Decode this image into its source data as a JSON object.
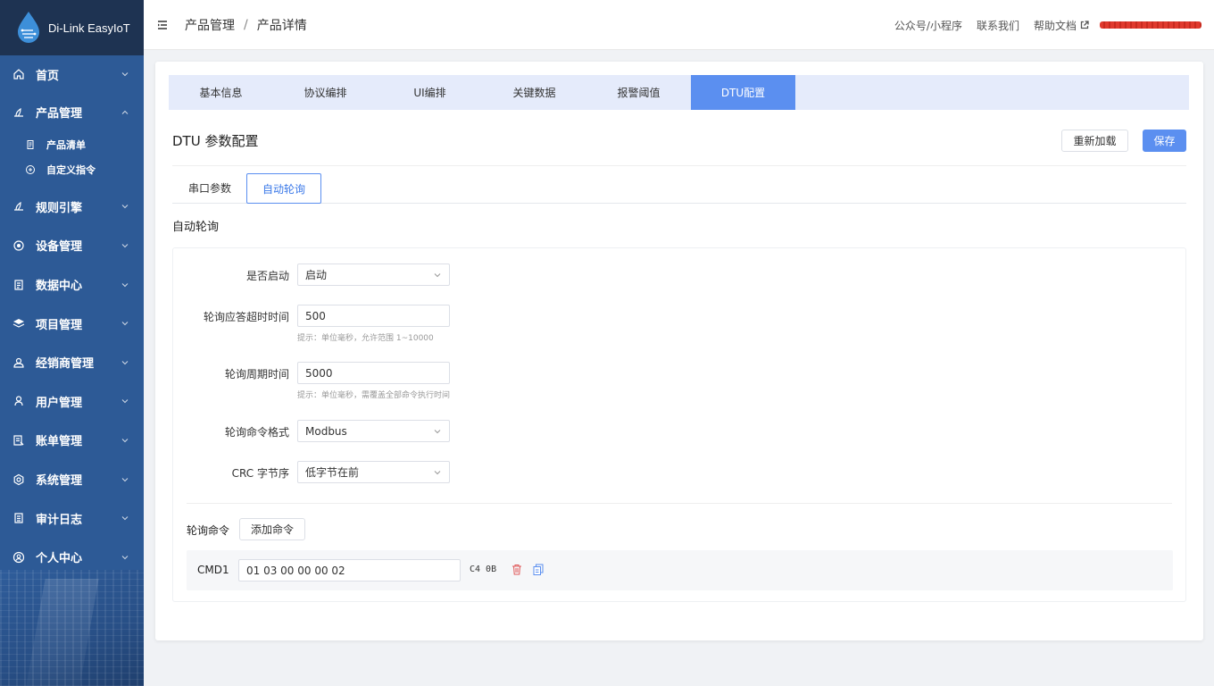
{
  "brand": {
    "name": "Di-Link EasyIoT"
  },
  "sidebar": {
    "items": [
      {
        "label": "首页",
        "icon": "home-icon"
      },
      {
        "label": "产品管理",
        "icon": "product-icon",
        "expanded": true,
        "children": [
          {
            "label": "产品清单",
            "icon": "list-icon"
          },
          {
            "label": "自定义指令",
            "icon": "command-icon"
          }
        ]
      },
      {
        "label": "规则引擎",
        "icon": "rule-icon"
      },
      {
        "label": "设备管理",
        "icon": "device-icon"
      },
      {
        "label": "数据中心",
        "icon": "data-icon"
      },
      {
        "label": "项目管理",
        "icon": "layers-icon"
      },
      {
        "label": "经销商管理",
        "icon": "dealer-icon"
      },
      {
        "label": "用户管理",
        "icon": "user-icon"
      },
      {
        "label": "账单管理",
        "icon": "bill-icon"
      },
      {
        "label": "系统管理",
        "icon": "settings-icon"
      },
      {
        "label": "审计日志",
        "icon": "log-icon"
      },
      {
        "label": "个人中心",
        "icon": "profile-icon"
      }
    ]
  },
  "header": {
    "breadcrumb": [
      "产品管理",
      "产品详情"
    ],
    "links": [
      "公众号/小程序",
      "联系我们",
      "帮助文档"
    ]
  },
  "tabs": [
    {
      "label": "基本信息",
      "active": false
    },
    {
      "label": "协议编排",
      "active": false
    },
    {
      "label": "UI编排",
      "active": false
    },
    {
      "label": "关键数据",
      "active": false
    },
    {
      "label": "报警阈值",
      "active": false
    },
    {
      "label": "DTU配置",
      "active": true
    }
  ],
  "config": {
    "title": "DTU 参数配置",
    "reload_label": "重新加载",
    "save_label": "保存",
    "subtabs": [
      "串口参数",
      "自动轮询"
    ],
    "section": "自动轮询",
    "fields": {
      "enable": {
        "label": "是否启动",
        "value": "启动"
      },
      "timeout": {
        "label": "轮询应答超时时间",
        "value": "500",
        "hint": "提示：单位毫秒，允许范围 1~10000"
      },
      "period": {
        "label": "轮询周期时间",
        "value": "5000",
        "hint": "提示：单位毫秒，需覆盖全部命令执行时间"
      },
      "format": {
        "label": "轮询命令格式",
        "value": "Modbus"
      },
      "crc": {
        "label": "CRC 字节序",
        "value": "低字节在前"
      }
    },
    "commands_title": "轮询命令",
    "add_command_label": "添加命令",
    "commands": [
      {
        "label": "CMD1",
        "value": "01 03 00 00 00 02",
        "crc": "C4 0B"
      }
    ]
  },
  "colors": {
    "primary": "#5b8ff0",
    "sidebar": "#2d5a96",
    "brand_bg": "#1e3352",
    "danger": "#e05a5a"
  }
}
